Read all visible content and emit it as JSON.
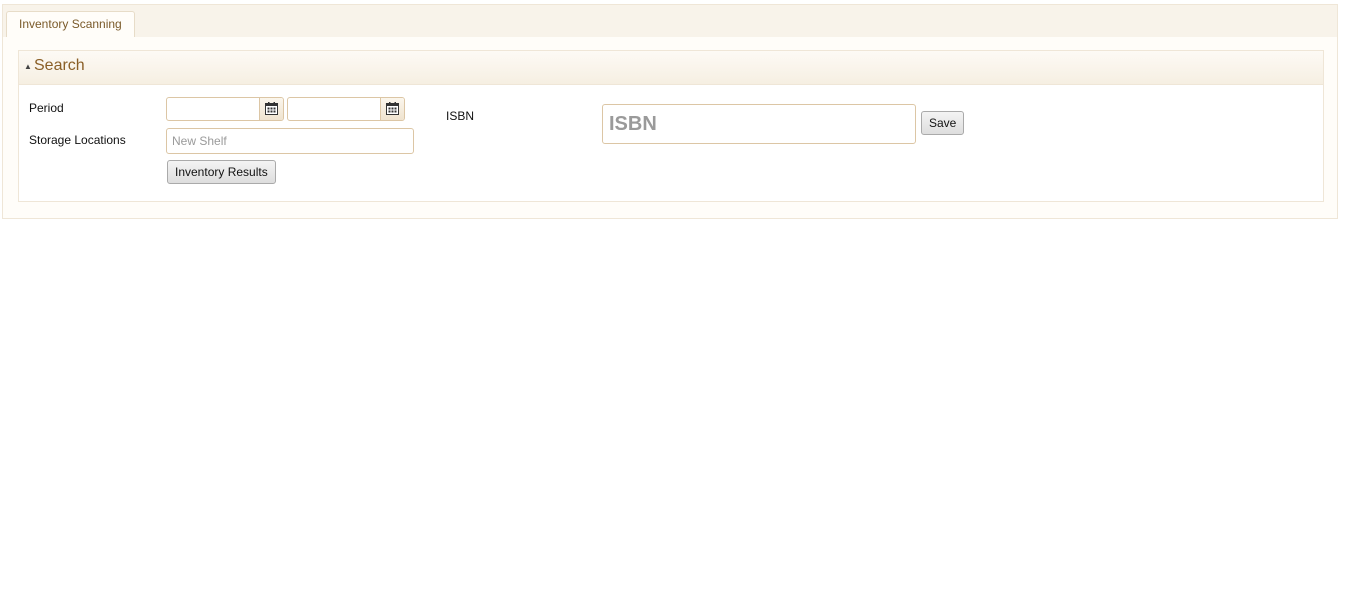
{
  "tabs": [
    {
      "label": "Inventory Scanning"
    }
  ],
  "search_panel": {
    "title": "Search",
    "collapse_icon": "triangle-up-icon",
    "period": {
      "label": "Period",
      "from_value": "",
      "to_value": "",
      "calendar_icon": "calendar-icon"
    },
    "storage_locations": {
      "label": "Storage Locations",
      "placeholder": "New Shelf",
      "value": ""
    },
    "inventory_results_button": "Inventory Results",
    "isbn": {
      "label": "ISBN",
      "placeholder": "ISBN",
      "value": ""
    },
    "save_button": "Save"
  },
  "colors": {
    "accent": "#8a5f27",
    "border": "#dcc6a5",
    "background": "#fbf8f3"
  }
}
